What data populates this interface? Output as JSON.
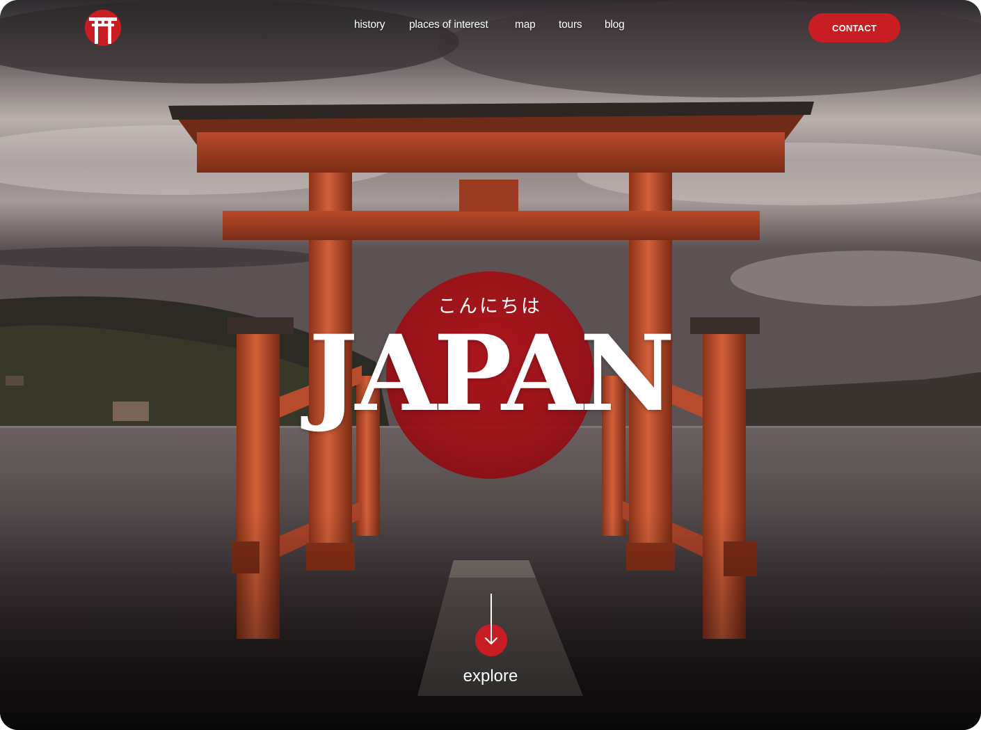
{
  "nav": {
    "logo_icon": "torii-gate-icon",
    "links": [
      {
        "label": "history"
      },
      {
        "label": "places of interest"
      },
      {
        "label": "map"
      },
      {
        "label": "tours"
      },
      {
        "label": "blog"
      }
    ],
    "contact_label": "CONTACT"
  },
  "hero": {
    "greeting": "こんにちは",
    "title": "JAPAN",
    "explore_label": "explore",
    "explore_icon": "arrow-down-icon"
  },
  "colors": {
    "accent": "#c81d23",
    "sun": "#a5121a",
    "torii": "#c8502f",
    "text": "#ffffff"
  }
}
